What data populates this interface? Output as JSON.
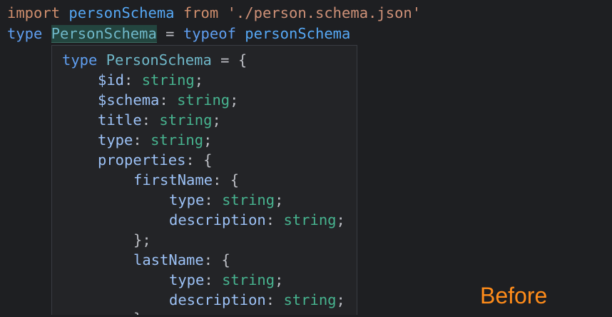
{
  "editor": {
    "line1": {
      "kw_import": "import",
      "ident": "personSchema",
      "kw_from": "from",
      "string": "'./person.schema.json'"
    },
    "line2": {
      "kw_type": "type",
      "type_name": "PersonSchema",
      "eq": "=",
      "kw_typeof": "typeof",
      "ident": "personSchema"
    }
  },
  "popup": {
    "lines": [
      {
        "kw": "type",
        "name": "PersonSchema",
        "rest": " = {"
      },
      {
        "prop": "$id",
        "sep": ": ",
        "type": "string",
        "end": ";"
      },
      {
        "prop": "$schema",
        "sep": ": ",
        "type": "string",
        "end": ";"
      },
      {
        "prop": "title",
        "sep": ": ",
        "type": "string",
        "end": ";"
      },
      {
        "prop": "type",
        "sep": ": ",
        "type": "string",
        "end": ";"
      },
      {
        "prop": "properties",
        "sep": ": ",
        "end": "{"
      },
      {
        "prop": "firstName",
        "sep": ": ",
        "end": "{"
      },
      {
        "prop": "type",
        "sep": ": ",
        "type": "string",
        "end": ";"
      },
      {
        "prop": "description",
        "sep": ": ",
        "type": "string",
        "end": ";"
      },
      {
        "close": "};"
      },
      {
        "prop": "lastName",
        "sep": ": ",
        "end": "{"
      },
      {
        "prop": "type",
        "sep": ": ",
        "type": "string",
        "end": ";"
      },
      {
        "prop": "description",
        "sep": ": ",
        "type": "string",
        "end": ";"
      },
      {
        "close": "}"
      }
    ]
  },
  "label": {
    "before": "Before"
  },
  "colors": {
    "background": "#1e1f22",
    "popup_background": "#232427",
    "keyword_orange": "#cf8e6d",
    "keyword_blue": "#5f9ef0",
    "string": "#ce9178",
    "type_string": "#47b38f",
    "label_orange": "#ff8c1a"
  }
}
